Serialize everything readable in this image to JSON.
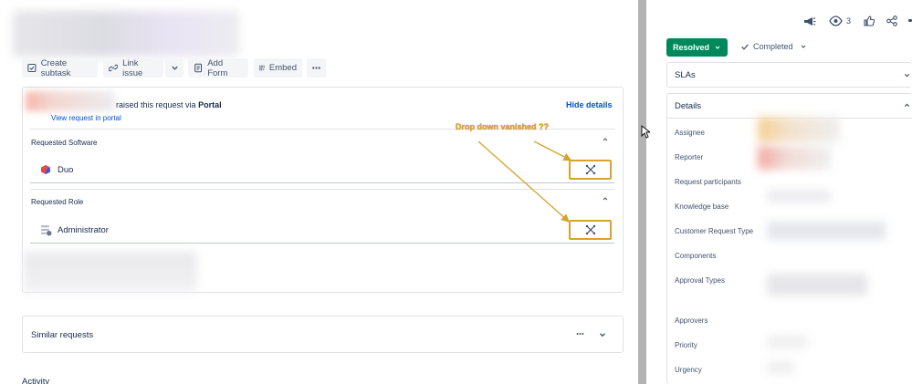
{
  "toolbar": {
    "create_subtask": "Create subtask",
    "link_issue": "Link issue",
    "add_form": "Add Form",
    "embed": "Embed"
  },
  "request": {
    "raised_text": "raised this request via",
    "channel": "Portal",
    "view_link": "View request in portal",
    "hide_details": "Hide details"
  },
  "fields": [
    {
      "label": "Requested Software",
      "value": "Duo"
    },
    {
      "label": "Requested Role",
      "value": "Administrator"
    }
  ],
  "annotation": {
    "text": "Drop down vanished ??",
    "color": "#d6a42a"
  },
  "similar": {
    "title": "Similar requests"
  },
  "activity": {
    "title": "Activity"
  },
  "right_panel": {
    "watch_count": "3",
    "status_button": "Resolved",
    "resolution": "Completed",
    "slas_title": "SLAs",
    "details_title": "Details",
    "detail_labels": [
      "Assignee",
      "Reporter",
      "Request participants",
      "Knowledge base",
      "Customer Request Type",
      "Components",
      "Approval Types",
      "Approvers",
      "Priority",
      "Urgency"
    ]
  },
  "colors": {
    "resolved_green": "#00875a",
    "link_blue": "#0052cc",
    "annotation_gold": "#d6a42a"
  }
}
